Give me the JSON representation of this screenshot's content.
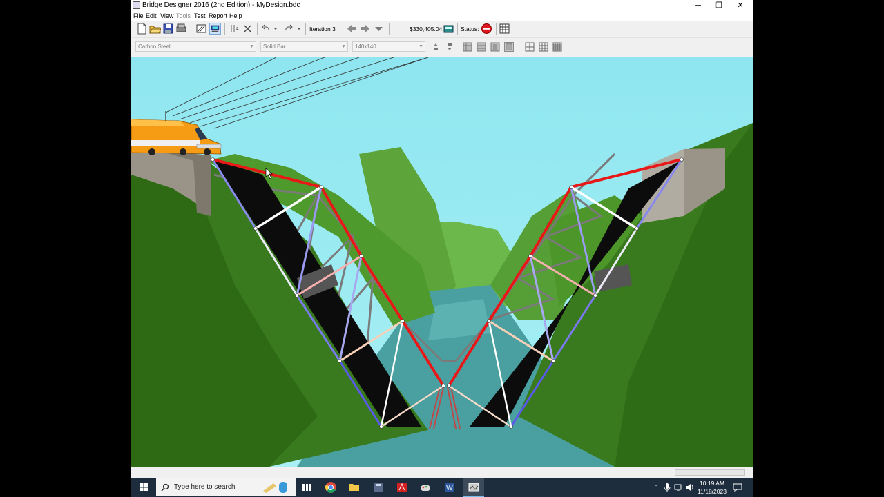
{
  "window": {
    "title": "Bridge Designer 2016 (2nd Edition) - MyDesign.bdc",
    "minimize_glyph": "─",
    "maximize_glyph": "❐",
    "close_glyph": "✕"
  },
  "menu": {
    "items": [
      "File",
      "Edit",
      "View",
      "Tools",
      "Test",
      "Report",
      "Help"
    ]
  },
  "toolbar": {
    "iteration_label": "Iteration 3",
    "cost": "$330,405.04",
    "status_label": "Status:",
    "status_color": "#e0141e"
  },
  "member_toolbar": {
    "material": "Carbon Steel",
    "cross_section": "Solid Bar",
    "size": "140x140"
  },
  "taskbar": {
    "search_placeholder": "Type here to search",
    "time": "10:19 AM",
    "date": "11/18/2023"
  },
  "colors": {
    "sky": "#93e8f0",
    "terrain": "#3f7f22",
    "water": "#4aa0a0",
    "compression_member": "#e81818",
    "tension_member": "#8080ee",
    "truck_cab": "#f59b14"
  }
}
